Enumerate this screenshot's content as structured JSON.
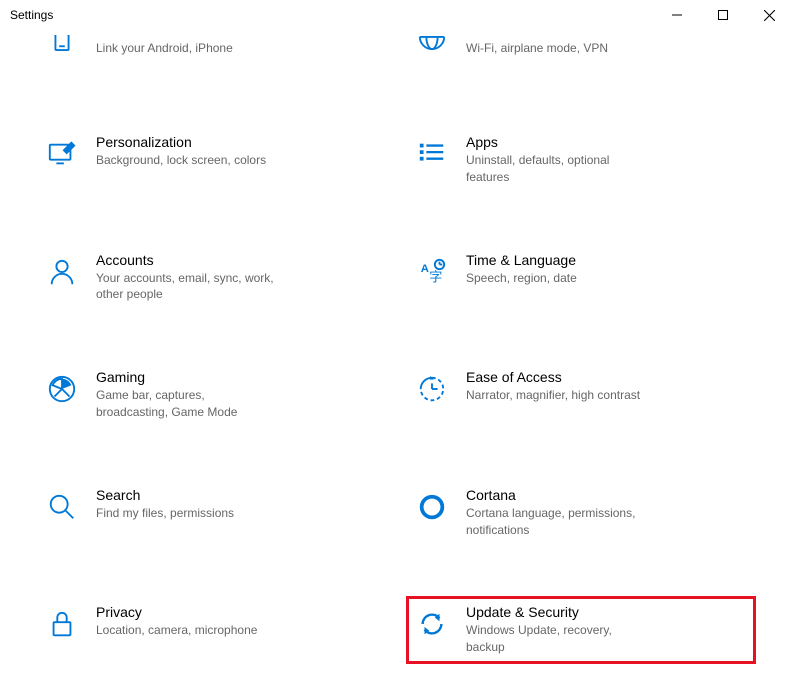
{
  "window": {
    "title": "Settings"
  },
  "colors": {
    "accent": "#0078d7",
    "highlight_border": "#e81123"
  },
  "items": [
    {
      "icon": "phone",
      "title": "",
      "desc": "Link your Android, iPhone"
    },
    {
      "icon": "globe",
      "title": "",
      "desc": "Wi-Fi, airplane mode, VPN"
    },
    {
      "icon": "personalization",
      "title": "Personalization",
      "desc": "Background, lock screen, colors"
    },
    {
      "icon": "apps",
      "title": "Apps",
      "desc": "Uninstall, defaults, optional features"
    },
    {
      "icon": "accounts",
      "title": "Accounts",
      "desc": "Your accounts, email, sync, work, other people"
    },
    {
      "icon": "time",
      "title": "Time & Language",
      "desc": "Speech, region, date"
    },
    {
      "icon": "gaming",
      "title": "Gaming",
      "desc": "Game bar, captures, broadcasting, Game Mode"
    },
    {
      "icon": "ease",
      "title": "Ease of Access",
      "desc": "Narrator, magnifier, high contrast"
    },
    {
      "icon": "search",
      "title": "Search",
      "desc": "Find my files, permissions"
    },
    {
      "icon": "cortana",
      "title": "Cortana",
      "desc": "Cortana language, permissions, notifications"
    },
    {
      "icon": "privacy",
      "title": "Privacy",
      "desc": "Location, camera, microphone"
    },
    {
      "icon": "update",
      "title": "Update & Security",
      "desc": "Windows Update, recovery, backup"
    }
  ]
}
